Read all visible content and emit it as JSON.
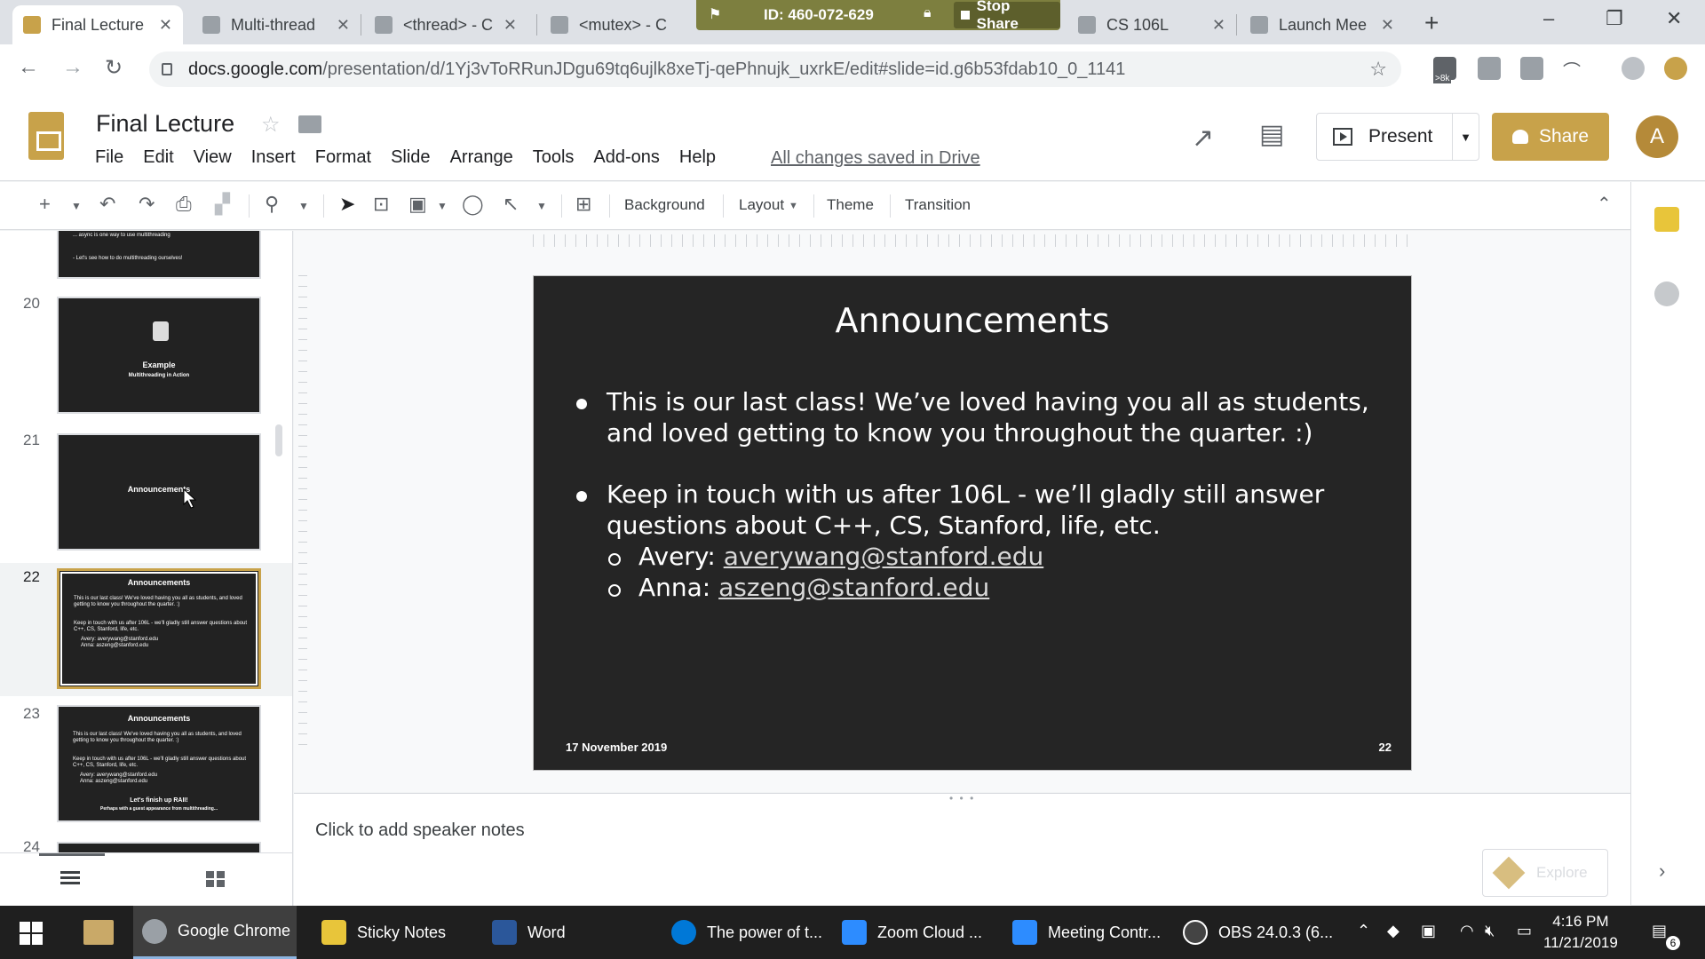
{
  "browser": {
    "tabs": [
      {
        "label": "Final Lecture",
        "active": true
      },
      {
        "label": "Multi-thread"
      },
      {
        "label": "<thread> - C"
      },
      {
        "label": "<mutex> - C"
      },
      {
        "label": "CS 106L"
      },
      {
        "label": "Launch Mee"
      }
    ],
    "share_banner": {
      "id_text": "ID: 460-072-629",
      "stop_label": "Stop Share"
    },
    "url_host": "docs.google.com",
    "url_path": "/presentation/d/1Yj3vToRRunJDgu69tq6ujlk8xeTj-qePhnujk_uxrkE/edit#slide=id.g6b53fdab10_0_1141",
    "extension_badge": ">8k"
  },
  "app": {
    "doc_title": "Final Lecture",
    "menu": [
      "File",
      "Edit",
      "View",
      "Insert",
      "Format",
      "Slide",
      "Arrange",
      "Tools",
      "Add-ons",
      "Help"
    ],
    "save_status": "All changes saved in Drive",
    "present_label": "Present",
    "share_label": "Share",
    "avatar_initial": "A",
    "accent_color": "#c8a24a"
  },
  "toolbar": {
    "background_label": "Background",
    "layout_label": "Layout",
    "theme_label": "Theme",
    "transition_label": "Transition"
  },
  "filmstrip": {
    "partial_top": {
      "line1": "... async is one way to use multithreading",
      "line2": "- Let's see how to do multithreading ourselves!"
    },
    "slides": [
      {
        "num": "20",
        "title": "Example",
        "subtitle": "Multithreading in Action"
      },
      {
        "num": "21",
        "title": "Announcements"
      },
      {
        "num": "22",
        "title": "Announcements",
        "selected": true
      },
      {
        "num": "23",
        "title": "Announcements",
        "extra": "Let's finish up RAII!",
        "extra2": "Perhaps with a guest appearance from multithreading..."
      },
      {
        "num": "24"
      }
    ],
    "thumb_lines": [
      "This is our last class! We've loved having you all as students, and loved getting to know you throughout the quarter. :)",
      "Keep in touch with us after 106L - we'll gladly still answer questions about C++, CS, Stanford, life, etc.",
      "Avery: averywang@stanford.edu",
      "Anna: aszeng@stanford.edu"
    ]
  },
  "slide": {
    "title": "Announcements",
    "bullet1": "This is our last class! We’ve loved having you all as students, and loved getting to know you throughout the quarter. :)",
    "bullet2": "Keep in touch with us after 106L - we’ll gladly still answer questions about C++, CS, Stanford, life, etc.",
    "contact1_name": "Avery: ",
    "contact1_email": "averywang@stanford.edu",
    "contact2_name": "Anna: ",
    "contact2_email": "aszeng@stanford.edu",
    "date": "17 November 2019",
    "number": "22"
  },
  "notes": {
    "placeholder": "Click to add speaker notes",
    "explore_label": "Explore"
  },
  "taskbar": {
    "apps": [
      {
        "label": "Google Chrome",
        "color": "#9aa0a6"
      },
      {
        "label": "Sticky Notes",
        "color": "#e8c53a"
      },
      {
        "label": "Word",
        "color": "#2b579a"
      },
      {
        "label": "The power of t...",
        "color": "#0078d7"
      },
      {
        "label": "Zoom Cloud ...",
        "color": "#2d8cff"
      },
      {
        "label": "Meeting Contr...",
        "color": "#2d8cff"
      },
      {
        "label": "OBS 24.0.3 (6...",
        "color": "#444444"
      }
    ],
    "time": "4:16 PM",
    "date": "11/21/2019",
    "notification_count": "6"
  }
}
